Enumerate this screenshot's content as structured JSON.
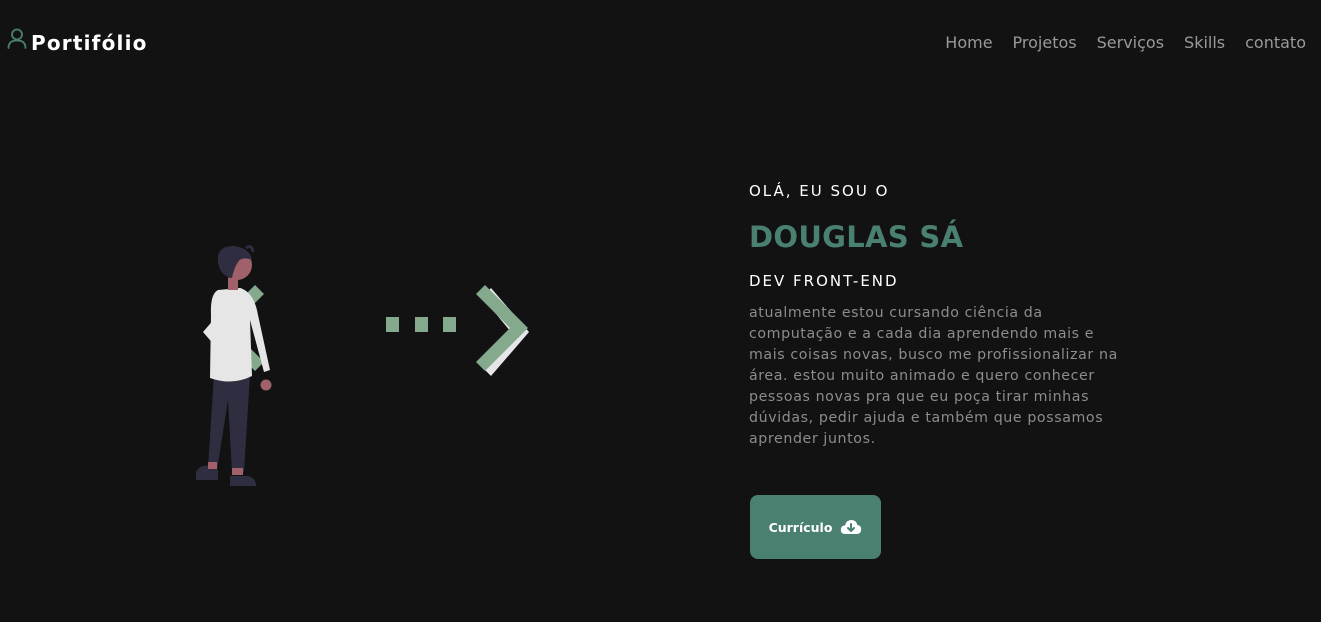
{
  "header": {
    "logo_text": "Portifólio",
    "logo_icon": "user-icon",
    "nav": [
      {
        "label": "Home"
      },
      {
        "label": "Projetos"
      },
      {
        "label": "Serviços"
      },
      {
        "label": "Skills"
      },
      {
        "label": "contato"
      }
    ]
  },
  "hero": {
    "greeting": "OLÁ, EU SOU O",
    "name": "DOUGLAS SÁ",
    "role": "DEV FRONT-END",
    "bio": " atualmente estou cursando ciência da computação e a cada dia aprendendo mais e mais coisas novas, busco me profissionalizar na área. estou muito animado e quero conhecer pessoas novas pra que eu poça tirar minhas dúvidas, pedir ajuda e também que possamos aprender juntos.",
    "cv_button_label": "Currículo",
    "cv_button_icon": "cloud-download-icon"
  },
  "colors": {
    "background": "#121212",
    "accent": "#4a8072",
    "illustration_green": "#84a98c",
    "nav_text": "#9a9a9a",
    "body_text": "#8c8c8c"
  }
}
